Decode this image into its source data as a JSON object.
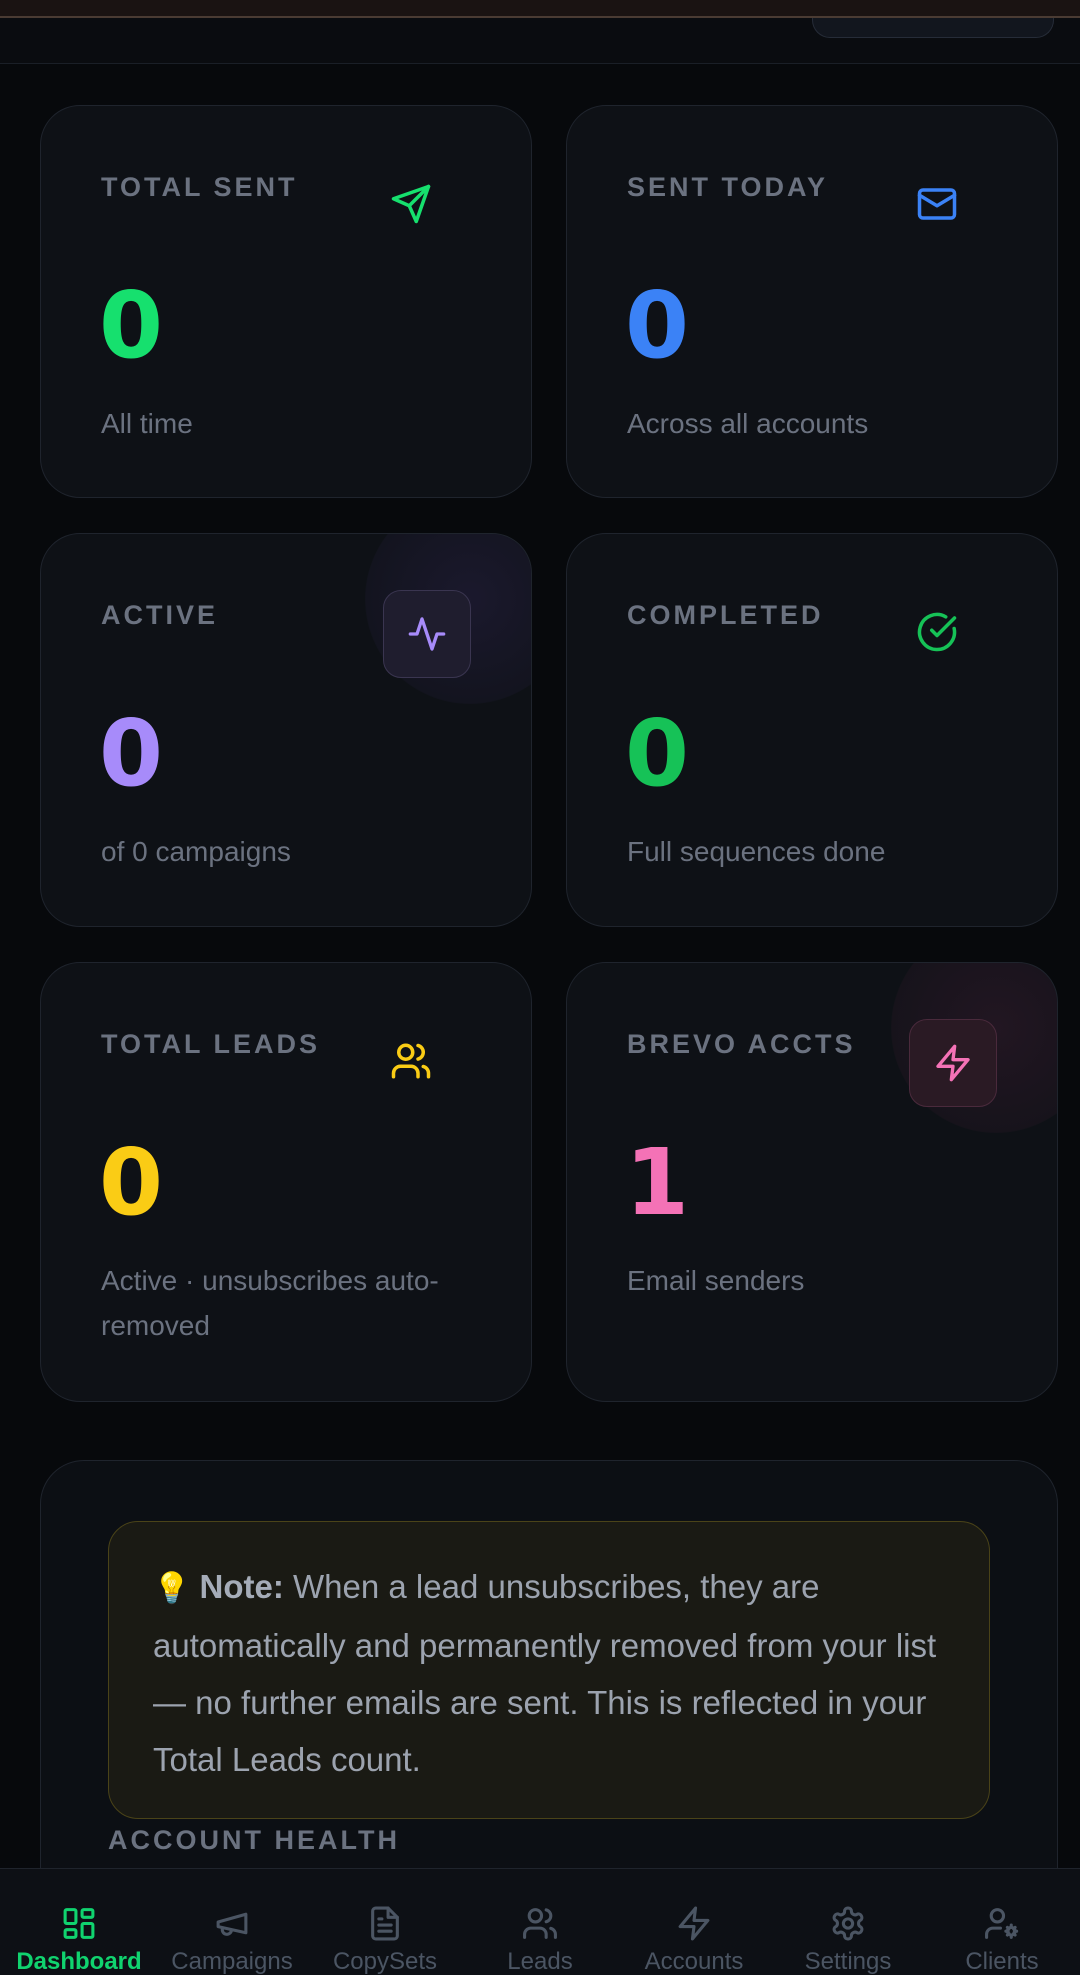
{
  "colors": {
    "green": "#16e06e",
    "blue": "#3b82f6",
    "purple": "#a78bfa",
    "green_dark": "#16c257",
    "yellow": "#facc15",
    "pink": "#f472b6",
    "nav_active": "#10d36f",
    "nav_inactive": "#4b5563"
  },
  "stats": [
    {
      "label": "TOTAL SENT",
      "value": "0",
      "sub": "All time",
      "icon": "send-icon"
    },
    {
      "label": "SENT TODAY",
      "value": "0",
      "sub": "Across all accounts",
      "icon": "mail-icon"
    },
    {
      "label": "ACTIVE",
      "value": "0",
      "sub": "of 0 campaigns",
      "icon": "activity-icon"
    },
    {
      "label": "COMPLETED",
      "value": "0",
      "sub": "Full sequences done",
      "icon": "check-circle-icon"
    },
    {
      "label": "TOTAL LEADS",
      "value": "0",
      "sub": "Active · unsubscribes auto-removed",
      "icon": "users-icon"
    },
    {
      "label": "BREVO ACCTS",
      "value": "1",
      "sub": "Email senders",
      "icon": "zap-icon"
    }
  ],
  "note": {
    "bulb": "💡",
    "title": "Note:",
    "text": " When a lead unsubscribes, they are automatically and permanently removed from your list — no further emails are sent. This is reflected in your Total Leads count."
  },
  "health_heading": "ACCOUNT HEALTH",
  "nav": [
    {
      "label": "Dashboard",
      "icon": "dashboard-icon",
      "active": true
    },
    {
      "label": "Campaigns",
      "icon": "megaphone-icon",
      "active": false
    },
    {
      "label": "CopySets",
      "icon": "file-text-icon",
      "active": false
    },
    {
      "label": "Leads",
      "icon": "users-icon",
      "active": false
    },
    {
      "label": "Accounts",
      "icon": "zap-icon",
      "active": false
    },
    {
      "label": "Settings",
      "icon": "settings-icon",
      "active": false
    },
    {
      "label": "Clients",
      "icon": "user-cog-icon",
      "active": false
    }
  ]
}
